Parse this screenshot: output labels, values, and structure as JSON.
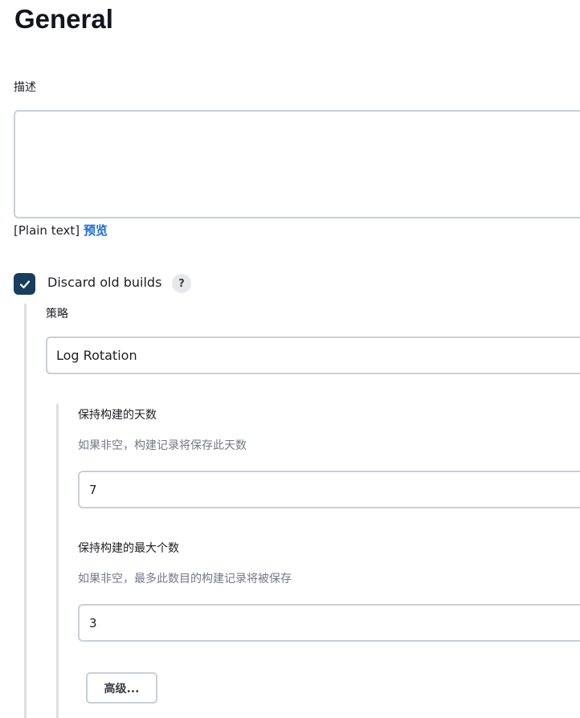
{
  "page": {
    "title": "General"
  },
  "description": {
    "label": "描述",
    "value": "",
    "format_label": "[Plain text]",
    "preview_link": "预览"
  },
  "discard_builds": {
    "checked": true,
    "label": "Discard old builds",
    "help": "?"
  },
  "strategy": {
    "label": "策略",
    "selected": "Log Rotation"
  },
  "days_to_keep": {
    "label": "保持构建的天数",
    "help_text": "如果非空，构建记录将保存此天数",
    "value": "7"
  },
  "max_builds": {
    "label": "保持构建的最大个数",
    "help_text": "如果非空，最多此数目的构建记录将被保存",
    "value": "3"
  },
  "advanced": {
    "label": "高级..."
  },
  "colors": {
    "checkbox_fill": "#183e5e",
    "link": "#1b6ad8",
    "border": "#c9cfd6",
    "help_text": "#727a86"
  }
}
